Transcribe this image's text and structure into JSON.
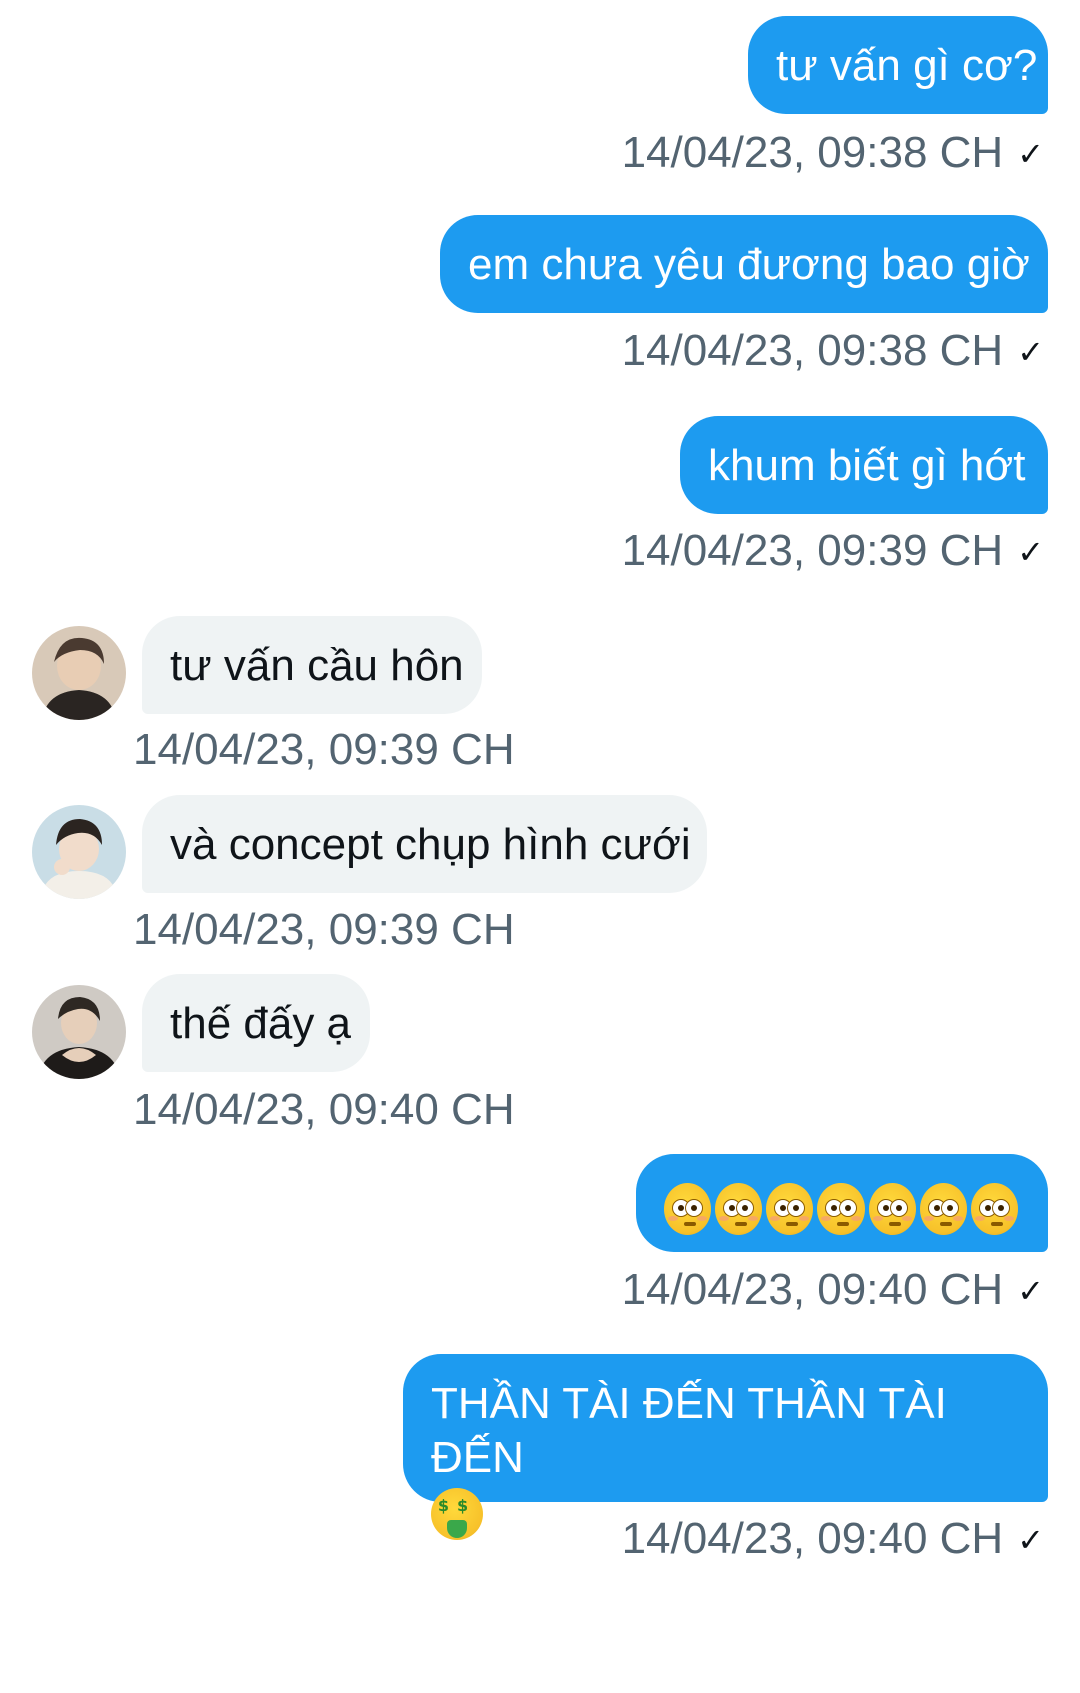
{
  "conversation": {
    "messages": [
      {
        "direction": "out",
        "text": "tư vấn gì cơ?",
        "timestamp": "14/04/23, 09:38 CH",
        "read_mark": "✓"
      },
      {
        "direction": "out",
        "text": "em chưa yêu đương bao giờ",
        "timestamp": "14/04/23, 09:38 CH",
        "read_mark": "✓"
      },
      {
        "direction": "out",
        "text": "khum biết gì hớt",
        "timestamp": "14/04/23, 09:39 CH",
        "read_mark": "✓"
      },
      {
        "direction": "in",
        "text": "tư vấn cầu hôn",
        "timestamp": "14/04/23, 09:39 CH",
        "avatar": "avatar-photo"
      },
      {
        "direction": "in",
        "text": "và concept chụp hình cưới",
        "timestamp": "14/04/23, 09:39 CH",
        "avatar": "avatar-photo"
      },
      {
        "direction": "in",
        "text": "thế đấy ạ",
        "timestamp": "14/04/23, 09:40 CH",
        "avatar": "avatar-photo"
      },
      {
        "direction": "out",
        "emoji": "flushed-face",
        "emoji_count": 7,
        "timestamp": "14/04/23, 09:40 CH",
        "read_mark": "✓"
      },
      {
        "direction": "out",
        "text": "THẦN TÀI ĐẾN THẦN TÀI ĐẾN",
        "emoji": "money-mouth-face",
        "timestamp": "14/04/23, 09:40 CH",
        "read_mark": "✓"
      }
    ]
  },
  "colors": {
    "outgoing_bubble": "#1d9bf0",
    "incoming_bubble": "#eff3f4",
    "timestamp_text": "#536471"
  }
}
